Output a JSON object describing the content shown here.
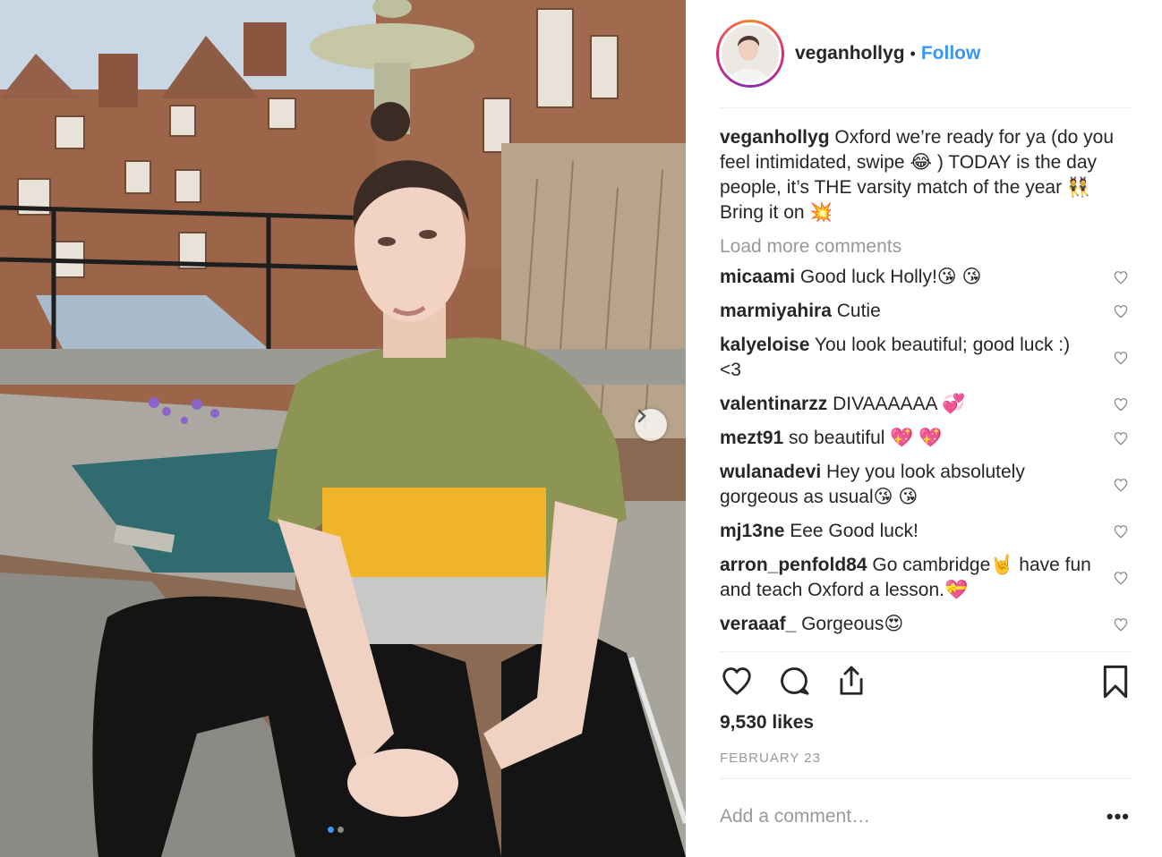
{
  "post": {
    "username": "veganhollyg",
    "separator": "•",
    "follow_label": "Follow",
    "caption_text": "Oxford we’re ready for ya (do you feel intimidated, swipe 😂 ) TODAY is the day people, it’s THE varsity match of the year 👯 Bring it on 💥",
    "load_more_label": "Load more comments",
    "likes": "9,530 likes",
    "date": "FEBRUARY 23",
    "add_comment_placeholder": "Add a comment…",
    "more_options": "•••",
    "carousel_count": 2,
    "carousel_active": 1
  },
  "comments": [
    {
      "user": "micaami",
      "text": "Good luck Holly!😘 😘"
    },
    {
      "user": "marmiyahira",
      "text": "Cutie"
    },
    {
      "user": "kalyeloise",
      "text": "You look beautiful; good luck :) <3"
    },
    {
      "user": "valentinarzz",
      "text": "DIVAAAAAA 💞"
    },
    {
      "user": "mezt91",
      "text": "so beautiful 💖 💖"
    },
    {
      "user": "wulanadevi",
      "text": "Hey you look absolutely gorgeous as usual😘 😘"
    },
    {
      "user": "mj13ne",
      "text": "Eee Good luck!"
    },
    {
      "user": "arron_penfold84",
      "text": "Go cambridge🤘 have fun and teach Oxford a lesson.💝"
    },
    {
      "user": "veraaaf_",
      "text": "Gorgeous😍"
    }
  ],
  "colors": {
    "link_blue": "#3897f0",
    "text": "#262626",
    "muted": "#999999",
    "divider": "#efefef"
  },
  "icons": {
    "like": "heart-icon",
    "comment": "comment-icon",
    "share": "share-icon",
    "save": "bookmark-icon",
    "carousel": "chevron-right-icon",
    "comment_like": "heart-icon"
  }
}
